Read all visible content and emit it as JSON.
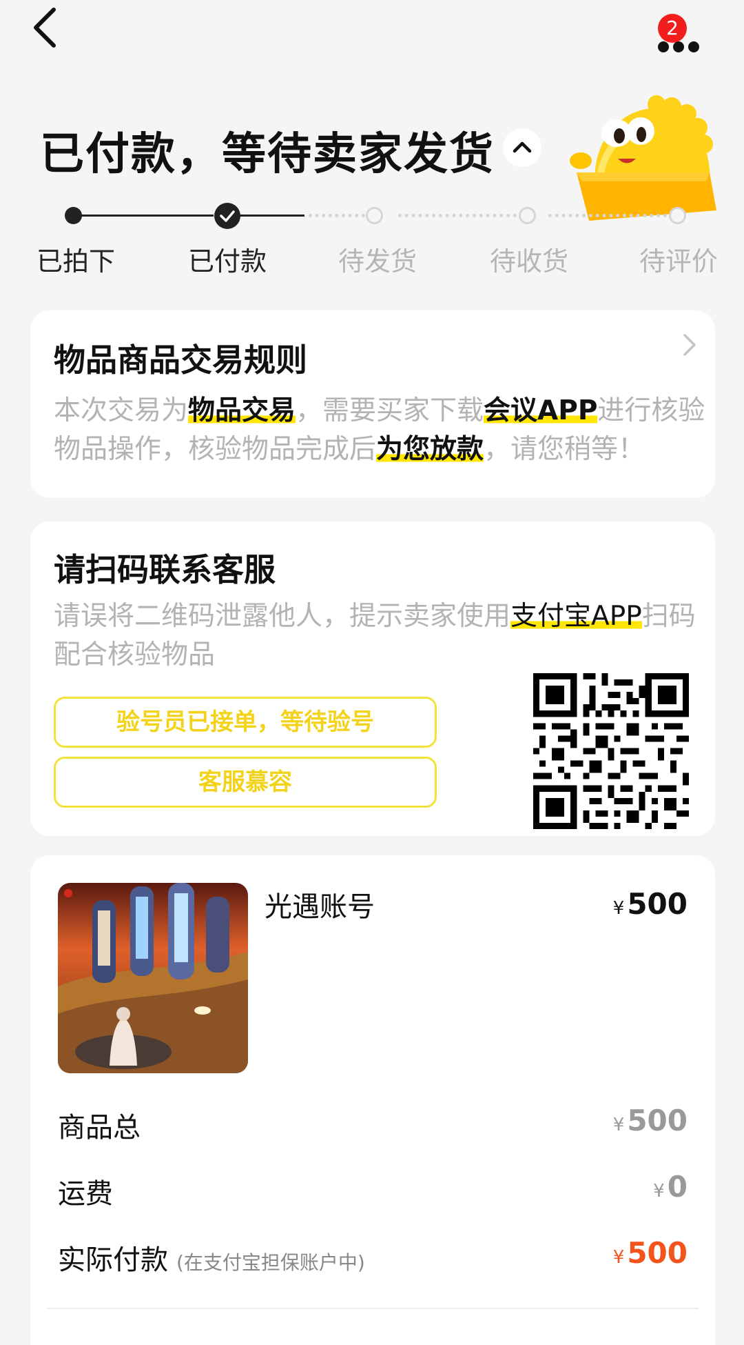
{
  "header": {
    "notification_count": "2"
  },
  "status": {
    "title": "已付款，等待卖家发货"
  },
  "steps": [
    {
      "label": "已拍下",
      "state": "done"
    },
    {
      "label": "已付款",
      "state": "current"
    },
    {
      "label": "待发货",
      "state": "pending"
    },
    {
      "label": "待收货",
      "state": "pending"
    },
    {
      "label": "待评价",
      "state": "pending"
    }
  ],
  "rules_card": {
    "title": "物品商品交易规则",
    "text_1": "本次交易为",
    "hl_1": "物品交易",
    "text_2": "，需要买家下载",
    "hl_2": "会议APP",
    "text_3": "进行核验物品操作，核验物品完成后",
    "hl_3": "为您放款",
    "text_4": "，请您稍等！"
  },
  "scan_card": {
    "title": "请扫码联系客服",
    "text_1": "请误将二维码泄露他人，提示卖家使用",
    "hl_1": "支付宝APP",
    "text_2": "扫码配合核验物品",
    "status_button": "验号员已接单，等待验号",
    "service_button": "客服慕容"
  },
  "order": {
    "product_name": "光遇账号",
    "currency": "¥",
    "product_price": "500",
    "subtotal_label": "商品总",
    "subtotal_value": "500",
    "shipping_label": "运费",
    "shipping_value": "0",
    "paid_label": "实际付款",
    "paid_note": "(在支付宝担保账户中)",
    "paid_value": "500"
  },
  "colors": {
    "accent_yellow": "#ffe600",
    "price_red": "#f2541b",
    "badge_red": "#f21d1d",
    "muted_text": "#b3b3b3"
  }
}
